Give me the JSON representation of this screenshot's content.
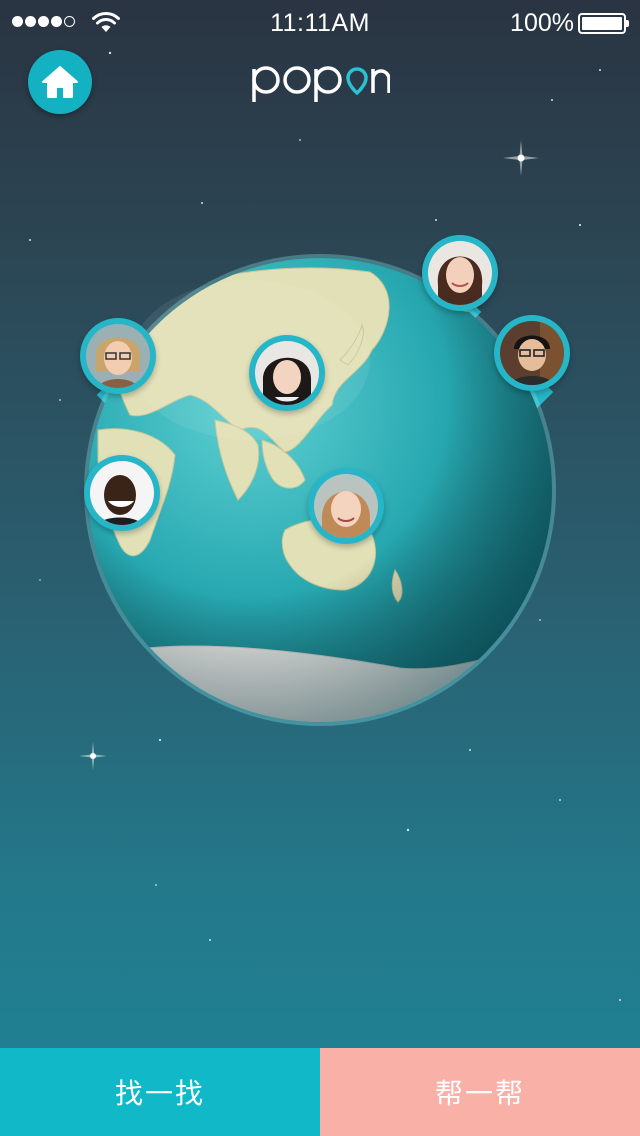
{
  "status_bar": {
    "time": "11:11AM",
    "battery": "100%",
    "signal_bars_filled": 4,
    "signal_bars_total": 5,
    "wifi_icon": "wifi-icon",
    "battery_icon": "battery-icon"
  },
  "header": {
    "app_name": "popon",
    "home_icon": "home-icon"
  },
  "map": {
    "pins": [
      {
        "name": "pin-user-1",
        "icon": "user-avatar"
      },
      {
        "name": "pin-user-2",
        "icon": "user-avatar"
      },
      {
        "name": "pin-user-3",
        "icon": "user-avatar"
      },
      {
        "name": "pin-user-4",
        "icon": "user-avatar"
      },
      {
        "name": "pin-user-5",
        "icon": "user-avatar"
      },
      {
        "name": "pin-user-6",
        "icon": "user-avatar"
      }
    ]
  },
  "tabs": {
    "find_label": "找一找",
    "help_label": "帮一帮"
  },
  "colors": {
    "accent": "#14b1c2",
    "find_tab": "#11b8c7",
    "help_tab": "#f9b0a7",
    "ocean": "#2aa5ad",
    "land": "#dfe0b8"
  }
}
